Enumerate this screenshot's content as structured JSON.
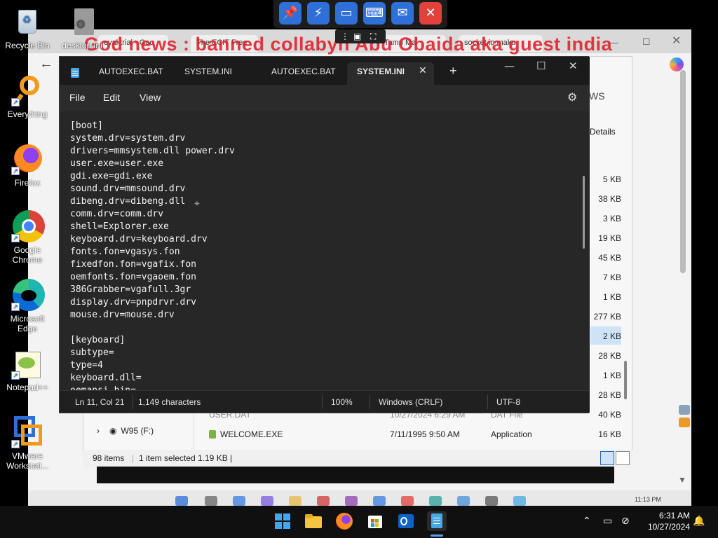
{
  "desktop_icons": [
    {
      "label": "Recycle Bin"
    },
    {
      "label": "desktop.ini"
    },
    {
      "label": "Everything"
    },
    {
      "label": "Firefox"
    },
    {
      "label": "Google Chrome"
    },
    {
      "label": "Microsoft Edge"
    },
    {
      "label": "Notepad++"
    },
    {
      "label": "VMware Workstati..."
    }
  ],
  "remote_toolbar": {
    "buttons": [
      "pin-icon",
      "lightning-icon",
      "monitor-icon",
      "keyboard-icon",
      "chat-icon",
      "close-icon"
    ]
  },
  "background": {
    "headline": "God news : banned collabyn Abu Obaida aka guest india",
    "browser_tabs": [
      "eval trial - Goo",
      "The ECIT Free",
      "Tamu Mai",
      "socket.io maku"
    ],
    "explorer": {
      "details_label": "Details",
      "partial_heading": "WS",
      "sizes": [
        "5 KB",
        "38 KB",
        "3 KB",
        "19 KB",
        "45 KB",
        "7 KB",
        "1 KB",
        "277 KB",
        "2 KB",
        "28 KB",
        "1 KB",
        "28 KB",
        "40 KB",
        "16 KB"
      ],
      "row_partial": {
        "name": "USER.DAT",
        "date": "10/27/2024 6:29 AM",
        "type": "DAT File"
      },
      "row_welcome": {
        "name": "WELCOME.EXE",
        "date": "7/11/1995 9:50 AM",
        "type": "Application"
      },
      "nav_drive": "W95 (F:)",
      "status": {
        "items": "98 items",
        "selected": "1 item selected",
        "size": "1.19 KB"
      }
    },
    "vm_clock": "11:13 PM"
  },
  "notepad": {
    "tabs": [
      {
        "label": "AUTOEXEC.BAT"
      },
      {
        "label": "SYSTEM.INI"
      },
      {
        "label": "AUTOEXEC.BAT"
      },
      {
        "label": "SYSTEM.INI",
        "active": true
      }
    ],
    "new_tab": "+",
    "menu": {
      "file": "File",
      "edit": "Edit",
      "view": "View"
    },
    "content": "[boot]\nsystem.drv=system.drv\ndrivers=mmsystem.dll power.drv\nuser.exe=user.exe\ngdi.exe=gdi.exe\nsound.drv=mmsound.drv\ndibeng.drv=dibeng.dll\ncomm.drv=comm.drv\nshell=Explorer.exe\nkeyboard.drv=keyboard.drv\nfonts.fon=vgasys.fon\nfixedfon.fon=vgafix.fon\noemfonts.fon=vgaoem.fon\n386Grabber=vgafull.3gr\ndisplay.drv=pnpdrvr.drv\nmouse.drv=mouse.drv\n\n[keyboard]\nsubtype=\ntype=4\nkeyboard.dll=\noemansi.bin=",
    "status": {
      "position": "Ln 11, Col 21",
      "characters": "1,149 characters",
      "zoom": "100%",
      "line_ending": "Windows (CRLF)",
      "encoding": "UTF-8"
    }
  },
  "taskbar": {
    "apps": [
      "windows-start-icon",
      "file-explorer-icon",
      "firefox-icon",
      "microsoft-store-icon",
      "outlook-icon",
      "notepad-icon"
    ],
    "time": "6:31 AM",
    "date": "10/27/2024"
  },
  "colors": {
    "notepad_bg": "#272727",
    "accent_blue": "#2f6fd8",
    "close_red": "#e2413c",
    "headline_red": "#e0242d"
  }
}
